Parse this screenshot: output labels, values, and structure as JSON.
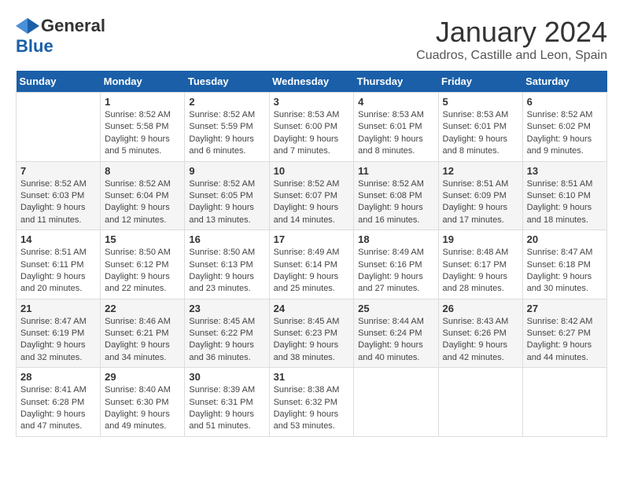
{
  "header": {
    "logo_general": "General",
    "logo_blue": "Blue",
    "month": "January 2024",
    "location": "Cuadros, Castille and Leon, Spain"
  },
  "weekdays": [
    "Sunday",
    "Monday",
    "Tuesday",
    "Wednesday",
    "Thursday",
    "Friday",
    "Saturday"
  ],
  "weeks": [
    [
      {
        "day": "",
        "info": ""
      },
      {
        "day": "1",
        "info": "Sunrise: 8:52 AM\nSunset: 5:58 PM\nDaylight: 9 hours\nand 5 minutes."
      },
      {
        "day": "2",
        "info": "Sunrise: 8:52 AM\nSunset: 5:59 PM\nDaylight: 9 hours\nand 6 minutes."
      },
      {
        "day": "3",
        "info": "Sunrise: 8:53 AM\nSunset: 6:00 PM\nDaylight: 9 hours\nand 7 minutes."
      },
      {
        "day": "4",
        "info": "Sunrise: 8:53 AM\nSunset: 6:01 PM\nDaylight: 9 hours\nand 8 minutes."
      },
      {
        "day": "5",
        "info": "Sunrise: 8:53 AM\nSunset: 6:01 PM\nDaylight: 9 hours\nand 8 minutes."
      },
      {
        "day": "6",
        "info": "Sunrise: 8:52 AM\nSunset: 6:02 PM\nDaylight: 9 hours\nand 9 minutes."
      }
    ],
    [
      {
        "day": "7",
        "info": "Sunrise: 8:52 AM\nSunset: 6:03 PM\nDaylight: 9 hours\nand 11 minutes."
      },
      {
        "day": "8",
        "info": "Sunrise: 8:52 AM\nSunset: 6:04 PM\nDaylight: 9 hours\nand 12 minutes."
      },
      {
        "day": "9",
        "info": "Sunrise: 8:52 AM\nSunset: 6:05 PM\nDaylight: 9 hours\nand 13 minutes."
      },
      {
        "day": "10",
        "info": "Sunrise: 8:52 AM\nSunset: 6:07 PM\nDaylight: 9 hours\nand 14 minutes."
      },
      {
        "day": "11",
        "info": "Sunrise: 8:52 AM\nSunset: 6:08 PM\nDaylight: 9 hours\nand 16 minutes."
      },
      {
        "day": "12",
        "info": "Sunrise: 8:51 AM\nSunset: 6:09 PM\nDaylight: 9 hours\nand 17 minutes."
      },
      {
        "day": "13",
        "info": "Sunrise: 8:51 AM\nSunset: 6:10 PM\nDaylight: 9 hours\nand 18 minutes."
      }
    ],
    [
      {
        "day": "14",
        "info": "Sunrise: 8:51 AM\nSunset: 6:11 PM\nDaylight: 9 hours\nand 20 minutes."
      },
      {
        "day": "15",
        "info": "Sunrise: 8:50 AM\nSunset: 6:12 PM\nDaylight: 9 hours\nand 22 minutes."
      },
      {
        "day": "16",
        "info": "Sunrise: 8:50 AM\nSunset: 6:13 PM\nDaylight: 9 hours\nand 23 minutes."
      },
      {
        "day": "17",
        "info": "Sunrise: 8:49 AM\nSunset: 6:14 PM\nDaylight: 9 hours\nand 25 minutes."
      },
      {
        "day": "18",
        "info": "Sunrise: 8:49 AM\nSunset: 6:16 PM\nDaylight: 9 hours\nand 27 minutes."
      },
      {
        "day": "19",
        "info": "Sunrise: 8:48 AM\nSunset: 6:17 PM\nDaylight: 9 hours\nand 28 minutes."
      },
      {
        "day": "20",
        "info": "Sunrise: 8:47 AM\nSunset: 6:18 PM\nDaylight: 9 hours\nand 30 minutes."
      }
    ],
    [
      {
        "day": "21",
        "info": "Sunrise: 8:47 AM\nSunset: 6:19 PM\nDaylight: 9 hours\nand 32 minutes."
      },
      {
        "day": "22",
        "info": "Sunrise: 8:46 AM\nSunset: 6:21 PM\nDaylight: 9 hours\nand 34 minutes."
      },
      {
        "day": "23",
        "info": "Sunrise: 8:45 AM\nSunset: 6:22 PM\nDaylight: 9 hours\nand 36 minutes."
      },
      {
        "day": "24",
        "info": "Sunrise: 8:45 AM\nSunset: 6:23 PM\nDaylight: 9 hours\nand 38 minutes."
      },
      {
        "day": "25",
        "info": "Sunrise: 8:44 AM\nSunset: 6:24 PM\nDaylight: 9 hours\nand 40 minutes."
      },
      {
        "day": "26",
        "info": "Sunrise: 8:43 AM\nSunset: 6:26 PM\nDaylight: 9 hours\nand 42 minutes."
      },
      {
        "day": "27",
        "info": "Sunrise: 8:42 AM\nSunset: 6:27 PM\nDaylight: 9 hours\nand 44 minutes."
      }
    ],
    [
      {
        "day": "28",
        "info": "Sunrise: 8:41 AM\nSunset: 6:28 PM\nDaylight: 9 hours\nand 47 minutes."
      },
      {
        "day": "29",
        "info": "Sunrise: 8:40 AM\nSunset: 6:30 PM\nDaylight: 9 hours\nand 49 minutes."
      },
      {
        "day": "30",
        "info": "Sunrise: 8:39 AM\nSunset: 6:31 PM\nDaylight: 9 hours\nand 51 minutes."
      },
      {
        "day": "31",
        "info": "Sunrise: 8:38 AM\nSunset: 6:32 PM\nDaylight: 9 hours\nand 53 minutes."
      },
      {
        "day": "",
        "info": ""
      },
      {
        "day": "",
        "info": ""
      },
      {
        "day": "",
        "info": ""
      }
    ]
  ]
}
